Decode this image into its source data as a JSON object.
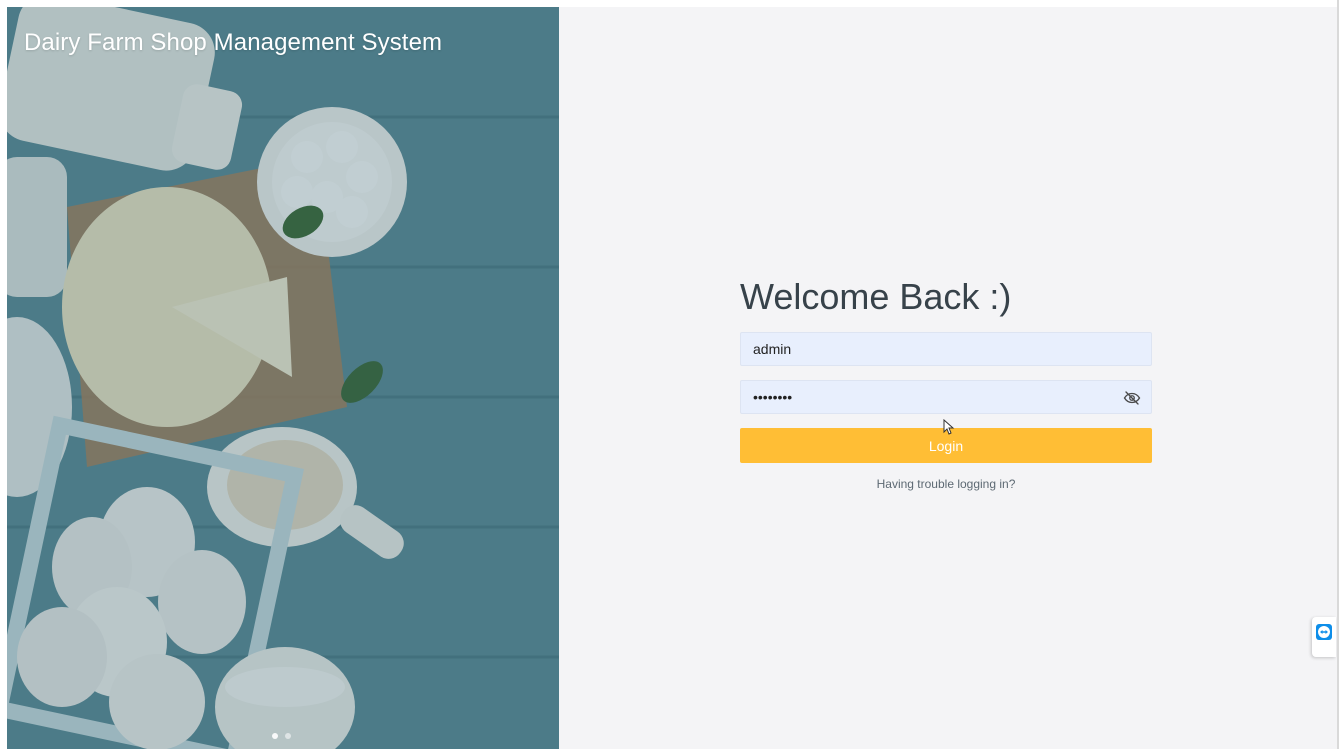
{
  "app": {
    "title": "Dairy Farm Shop Management System"
  },
  "login": {
    "heading": "Welcome Back :)",
    "username_value": "admin",
    "password_value": "********",
    "login_label": "Login",
    "trouble_link": "Having trouble logging in?"
  },
  "carousel": {
    "slides": 2,
    "active_index": 0
  },
  "colors": {
    "login_button": "#ffbe35",
    "input_background": "#e8effd",
    "panel_background": "#f4f4f6",
    "heading": "#37424a"
  },
  "icons": [
    "eye-off-icon",
    "teamviewer-icon"
  ]
}
